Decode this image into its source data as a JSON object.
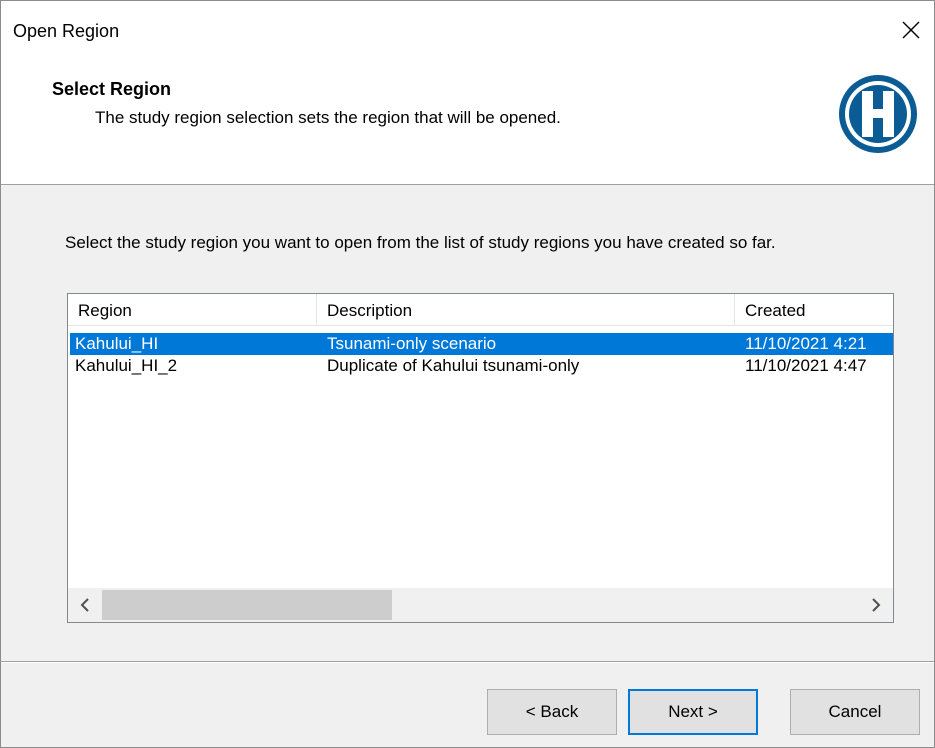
{
  "window": {
    "title": "Open Region"
  },
  "header": {
    "title": "Select Region",
    "subtitle": "The study region selection sets the region that will be opened."
  },
  "body": {
    "instructions": "Select the study region you want to open from the list of study regions you have created so far."
  },
  "list": {
    "columns": [
      "Region",
      "Description",
      "Created"
    ],
    "rows": [
      {
        "region": "Kahului_HI",
        "description": "Tsunami-only scenario",
        "created": "11/10/2021 4:21"
      },
      {
        "region": "Kahului_HI_2",
        "description": "Duplicate of Kahului tsunami-only",
        "created": "11/10/2021 4:47"
      }
    ],
    "selected_index": 0
  },
  "buttons": {
    "back": "< Back",
    "next": "Next >",
    "cancel": "Cancel"
  },
  "colors": {
    "selection": "#0078d7",
    "logo": "#0b5c94"
  }
}
